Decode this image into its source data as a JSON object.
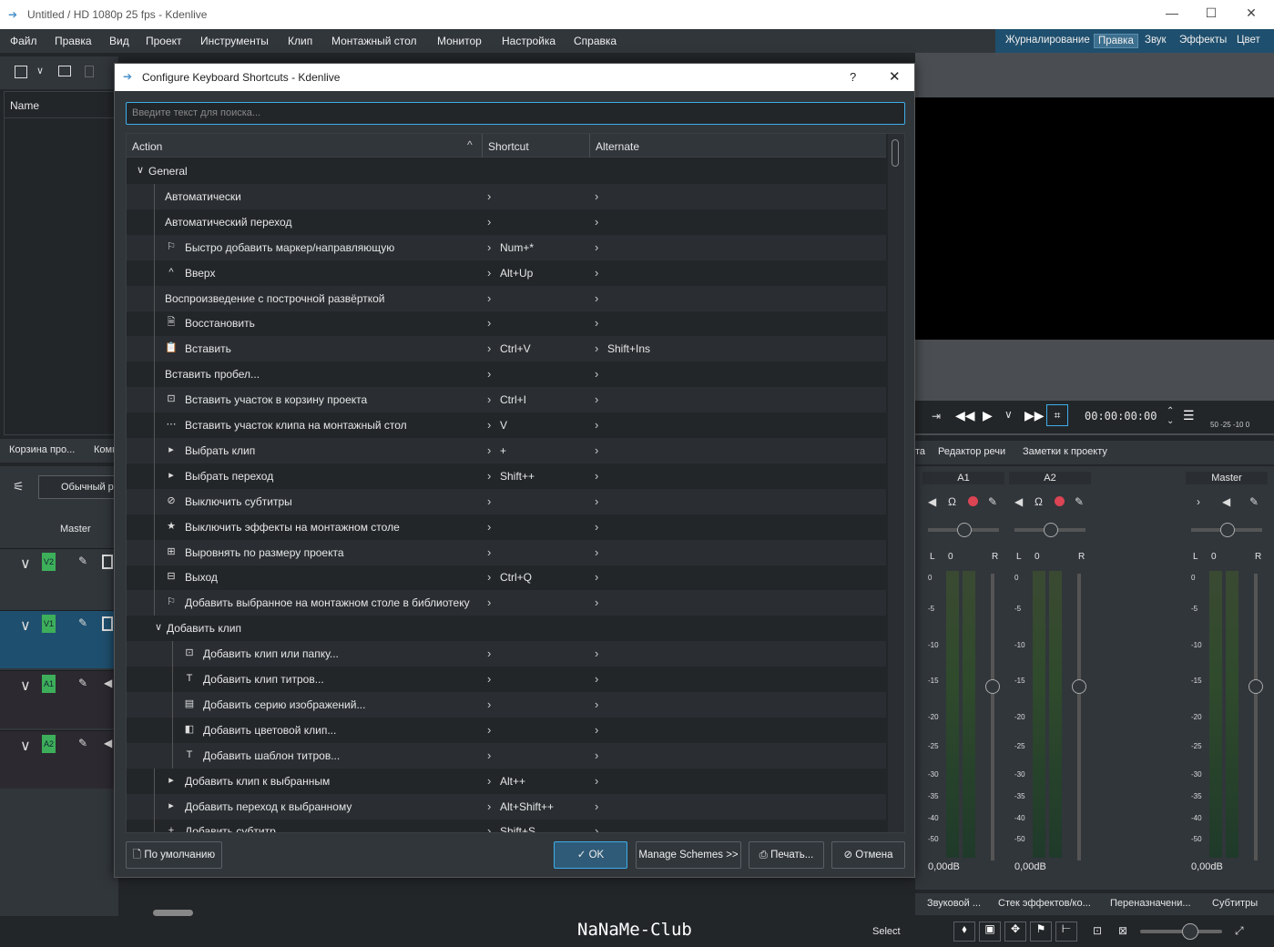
{
  "window": {
    "title": "Untitled / HD 1080p 25 fps - Kdenlive"
  },
  "menu": [
    "Файл",
    "Правка",
    "Вид",
    "Проект",
    "Инструменты",
    "Клип",
    "Монтажный стол",
    "Монитор",
    "Настройка",
    "Справка"
  ],
  "layouts": [
    "Журналирование",
    "Правка",
    "Звук",
    "Эффекты",
    "Цвет"
  ],
  "bin": {
    "header": "Name",
    "tabs": [
      "Корзина про...",
      "Комп"
    ],
    "mode": "Обычный р"
  },
  "timeline": {
    "master": "Master",
    "tracks": [
      "V2",
      "V1",
      "A1",
      "A2"
    ]
  },
  "monitor": {
    "timecode": "00:00:00:00",
    "vu_scale": "50 -25 -10 0",
    "tabs": [
      "та",
      "Редактор речи",
      "Заметки к проекту"
    ]
  },
  "mixer": {
    "channels": [
      {
        "name": "A1",
        "l": "L",
        "val": "0",
        "r": "R",
        "db": "0,00dB"
      },
      {
        "name": "A2",
        "l": "L",
        "val": "0",
        "r": "R",
        "db": "0,00dB"
      },
      {
        "name": "Master",
        "l": "L",
        "val": "0",
        "r": "R",
        "db": "0,00dB"
      }
    ],
    "scale": [
      "0",
      "-5",
      "-10",
      "-15",
      "-20",
      "-25",
      "-30",
      "-35",
      "-40",
      "-50"
    ]
  },
  "bottom_tabs": [
    "Звуковой ...",
    "Стек эффектов/ко...",
    "Переназначени...",
    "Субтитры"
  ],
  "status": {
    "select": "Select",
    "watermark": "NaNaMe-Club"
  },
  "dialog": {
    "title": "Configure Keyboard Shortcuts - Kdenlive",
    "help": "?",
    "search_placeholder": "Введите текст для поиска...",
    "columns": {
      "action": "Action",
      "shortcut": "Shortcut",
      "alternate": "Alternate"
    },
    "rows": [
      {
        "label": "General",
        "level": 0,
        "expander": "down",
        "icon": "",
        "shortcut": "",
        "alternate": "",
        "chevrons": false
      },
      {
        "label": "Автоматически",
        "level": 1,
        "icon": "",
        "shortcut": "",
        "alternate": "",
        "chevrons": true
      },
      {
        "label": "Автоматический переход",
        "level": 1,
        "icon": "",
        "shortcut": "",
        "alternate": "",
        "chevrons": true
      },
      {
        "label": "Быстро добавить маркер/направляющую",
        "level": 1,
        "icon": "bookmark-icon",
        "shortcut": "Num+*",
        "alternate": "",
        "chevrons": true
      },
      {
        "label": "Вверх",
        "level": 1,
        "icon": "chevron-up-icon",
        "shortcut": "Alt+Up",
        "alternate": "",
        "chevrons": true
      },
      {
        "label": "Воспроизведение с построчной развёрткой",
        "level": 1,
        "icon": "",
        "shortcut": "",
        "alternate": "",
        "chevrons": true
      },
      {
        "label": "Восстановить",
        "level": 1,
        "icon": "document-revert-icon",
        "shortcut": "",
        "alternate": "",
        "chevrons": true
      },
      {
        "label": "Вставить",
        "level": 1,
        "icon": "paste-icon",
        "shortcut": "Ctrl+V",
        "alternate": "Shift+Ins",
        "chevrons": true
      },
      {
        "label": "Вставить пробел...",
        "level": 1,
        "icon": "",
        "shortcut": "",
        "alternate": "",
        "chevrons": true
      },
      {
        "label": "Вставить участок в корзину проекта",
        "level": 1,
        "icon": "bin-add-icon",
        "shortcut": "Ctrl+I",
        "alternate": "",
        "chevrons": true
      },
      {
        "label": "Вставить участок клипа на монтажный стол",
        "level": 1,
        "icon": "timeline-insert-icon",
        "shortcut": "V",
        "alternate": "",
        "chevrons": true
      },
      {
        "label": "Выбрать клип",
        "level": 1,
        "icon": "select-arrow-icon",
        "shortcut": "+",
        "alternate": "",
        "chevrons": true
      },
      {
        "label": "Выбрать переход",
        "level": 1,
        "icon": "select-arrow-icon",
        "shortcut": "Shift++",
        "alternate": "",
        "chevrons": true
      },
      {
        "label": "Выключить субтитры",
        "level": 1,
        "icon": "subtitles-off-icon",
        "shortcut": "",
        "alternate": "",
        "chevrons": true
      },
      {
        "label": "Выключить эффекты на монтажном столе",
        "level": 1,
        "icon": "star-icon",
        "shortcut": "",
        "alternate": "",
        "chevrons": true
      },
      {
        "label": "Выровнять по размеру проекта",
        "level": 1,
        "icon": "fit-icon",
        "shortcut": "",
        "alternate": "",
        "chevrons": true
      },
      {
        "label": "Выход",
        "level": 1,
        "icon": "exit-icon",
        "shortcut": "Ctrl+Q",
        "alternate": "",
        "chevrons": true
      },
      {
        "label": "Добавить выбранное на монтажном столе в библиотеку",
        "level": 1,
        "icon": "bookmark-icon",
        "shortcut": "",
        "alternate": "",
        "chevrons": true
      },
      {
        "label": "Добавить клип",
        "level": 1,
        "expander": "down",
        "icon": "",
        "shortcut": "",
        "alternate": "",
        "chevrons": false
      },
      {
        "label": "Добавить клип или папку...",
        "level": 2,
        "icon": "add-clip-icon",
        "shortcut": "",
        "alternate": "",
        "chevrons": true
      },
      {
        "label": "Добавить клип титров...",
        "level": 2,
        "icon": "title-icon",
        "shortcut": "",
        "alternate": "",
        "chevrons": true
      },
      {
        "label": "Добавить серию изображений...",
        "level": 2,
        "icon": "image-sequence-icon",
        "shortcut": "",
        "alternate": "",
        "chevrons": true
      },
      {
        "label": "Добавить цветовой клип...",
        "level": 2,
        "icon": "color-clip-icon",
        "shortcut": "",
        "alternate": "",
        "chevrons": true
      },
      {
        "label": "Добавить шаблон титров...",
        "level": 2,
        "icon": "title-icon",
        "shortcut": "",
        "alternate": "",
        "chevrons": true
      },
      {
        "label": "Добавить клип к выбранным",
        "level": 1,
        "icon": "select-arrow-icon",
        "shortcut": "Alt++",
        "alternate": "",
        "chevrons": true
      },
      {
        "label": "Добавить переход к выбранному",
        "level": 1,
        "icon": "select-arrow-icon",
        "shortcut": "Alt+Shift++",
        "alternate": "",
        "chevrons": true
      },
      {
        "label": "Добавить субтитр",
        "level": 1,
        "icon": "plus-icon",
        "shortcut": "Shift+S",
        "alternate": "",
        "chevrons": true
      }
    ],
    "buttons": {
      "defaults": "По умолчанию",
      "ok": "OK",
      "schemes": "Manage Schemes >>",
      "print": "Печать...",
      "cancel": "Отмена"
    }
  },
  "colors": {
    "accent": "#3daee9",
    "track_badge": "#3daf5a",
    "record": "#da4453"
  }
}
